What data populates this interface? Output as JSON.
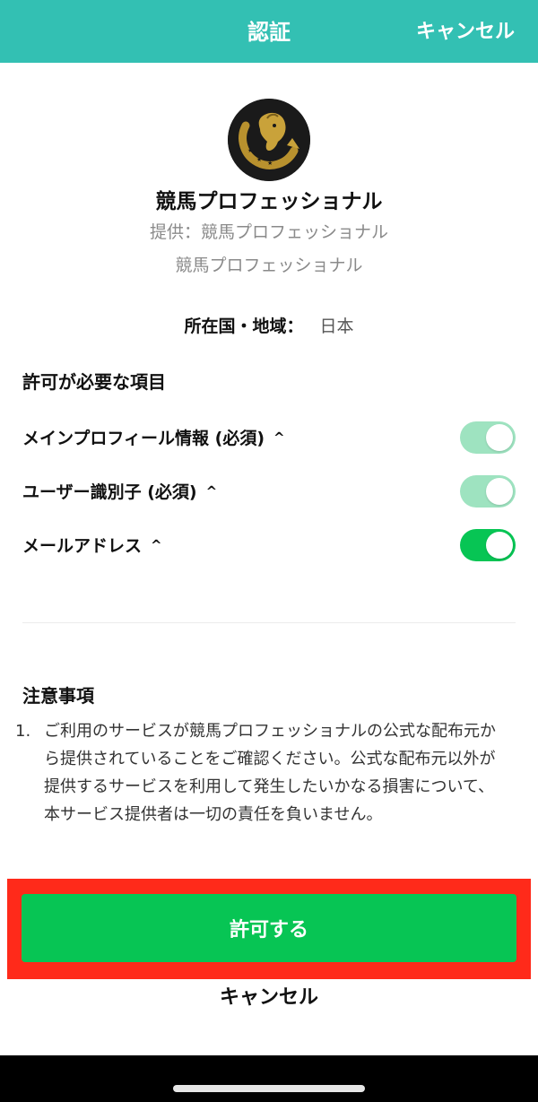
{
  "header": {
    "title": "認証",
    "cancel_label": "キャンセル"
  },
  "app": {
    "logo_icon": "horse-horseshoe-logo-icon",
    "name": "競馬プロフェッショナル",
    "provider_line": "提供：競馬プロフェッショナル",
    "provider_line_2": "競馬プロフェッショナル",
    "country_label": "所在国・地域：",
    "country_value": "日本"
  },
  "permissions": {
    "heading": "許可が必要な項目",
    "items": [
      {
        "label": "メインプロフィール情報 (必須)",
        "chevron": "^",
        "enabled": true,
        "required": true
      },
      {
        "label": "ユーザー識別子 (必須)",
        "chevron": "^",
        "enabled": true,
        "required": true
      },
      {
        "label": "メールアドレス",
        "chevron": "^",
        "enabled": true,
        "required": false
      }
    ]
  },
  "notes": {
    "heading": "注意事項",
    "items": [
      {
        "number": "1.",
        "text": "ご利用のサービスが競馬プロフェッショナルの公式な配布元から提供されていることをご確認ください。公式な配布元以外が提供するサービスを利用して発生したいかなる損害について、本サービス提供者は一切の責任を負いません。"
      }
    ]
  },
  "actions": {
    "allow_label": "許可する",
    "cancel_label": "キャンセル"
  },
  "colors": {
    "header_bg": "#33c0b3",
    "primary_green": "#07c554",
    "toggle_light": "#9ee3c0",
    "highlight_red": "#ff2a1a"
  }
}
